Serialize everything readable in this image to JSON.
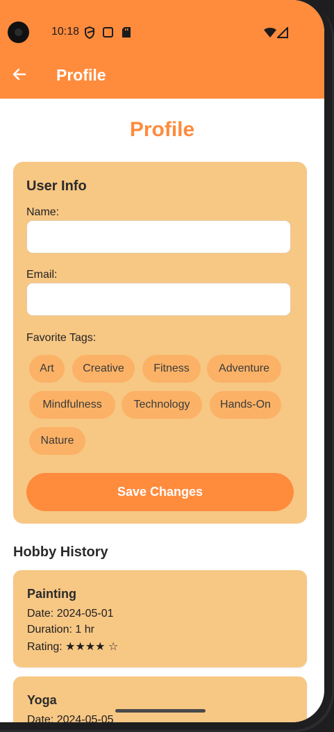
{
  "status_bar": {
    "time": "10:18"
  },
  "app_bar": {
    "title": "Profile"
  },
  "page": {
    "title": "Profile"
  },
  "user_info": {
    "title": "User Info",
    "name_label": "Name:",
    "name_value": "",
    "email_label": "Email:",
    "email_value": "",
    "tags_label": "Favorite Tags:",
    "tags": [
      "Art",
      "Creative",
      "Fitness",
      "Adventure",
      "Mindfulness",
      "Technology",
      "Hands-On",
      "Nature"
    ],
    "save_label": "Save Changes"
  },
  "hobby_history": {
    "title": "Hobby History",
    "entries": [
      {
        "name": "Painting",
        "date": "Date: 2024-05-01",
        "duration": "Duration: 1 hr",
        "rating": "Rating: ★★★★ ☆"
      },
      {
        "name": "Yoga",
        "date": "Date: 2024-05-05"
      }
    ]
  },
  "colors": {
    "accent": "#ff8b3d",
    "card": "#f7c784",
    "tag": "#fbb266"
  }
}
